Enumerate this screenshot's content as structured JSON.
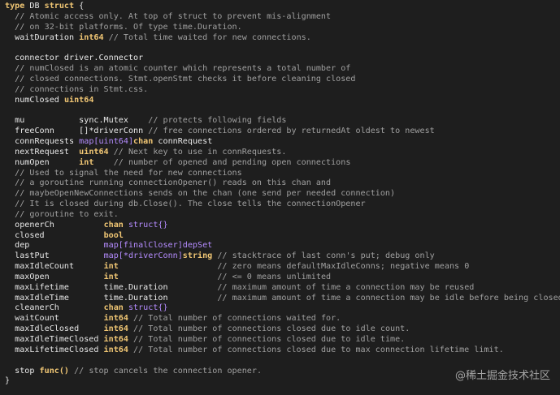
{
  "code": {
    "header": {
      "kw_type": "type",
      "name": "DB",
      "kw_struct": "struct",
      "brace": "{"
    },
    "lines": [
      "// Atomic access only. At top of struct to prevent mis-alignment",
      "// on 32-bit platforms. Of type time.Duration.",
      "waitDuration",
      "int64",
      "// Total time waited for new connections.",
      "connector driver.Connector",
      "// numClosed is an atomic counter which represents a total number of",
      "// closed connections. Stmt.openStmt checks it before cleaning closed",
      "// connections in Stmt.css.",
      "numClosed",
      "uint64"
    ],
    "fields": {
      "mu": {
        "name": "mu",
        "type": "sync.Mutex",
        "comment": "// protects following fields"
      },
      "freeConn": {
        "name": "freeConn",
        "type": "[]*driverConn",
        "comment": "// free connections ordered by returnedAt oldest to newest"
      },
      "connRequests": {
        "name": "connRequests",
        "type": "map[uint64]",
        "type2": "chan",
        "type3": "connRequest"
      },
      "nextRequest": {
        "name": "nextRequest",
        "type": "uint64",
        "comment": "// Next key to use in connRequests."
      },
      "numOpen": {
        "name": "numOpen",
        "type": "int",
        "comment": "// number of opened and pending open connections"
      },
      "c1": "// Used to signal the need for new connections",
      "c2": "// a goroutine running connectionOpener() reads on this chan and",
      "c3": "// maybeOpenNewConnections sends on the chan (one send per needed connection)",
      "c4": "// It is closed during db.Close(). The close tells the connectionOpener",
      "c5": "// goroutine to exit.",
      "openerCh": {
        "name": "openerCh",
        "type": "chan",
        "type2": "struct{}"
      },
      "closed": {
        "name": "closed",
        "type": "bool"
      },
      "dep": {
        "name": "dep",
        "type": "map[finalCloser]depSet"
      },
      "lastPut": {
        "name": "lastPut",
        "type": "map[*driverConn]",
        "type2": "string",
        "comment": "// stacktrace of last conn's put; debug only"
      },
      "maxIdleCount": {
        "name": "maxIdleCount",
        "type": "int",
        "comment": "// zero means defaultMaxIdleConns; negative means 0"
      },
      "maxOpen": {
        "name": "maxOpen",
        "type": "int",
        "comment": "// <= 0 means unlimited"
      },
      "maxLifetime": {
        "name": "maxLifetime",
        "type": "time.Duration",
        "comment": "// maximum amount of time a connection may be reused"
      },
      "maxIdleTime": {
        "name": "maxIdleTime",
        "type": "time.Duration",
        "comment": "// maximum amount of time a connection may be idle before being closed"
      },
      "cleanerCh": {
        "name": "cleanerCh",
        "type": "chan",
        "type2": "struct{}"
      },
      "waitCount": {
        "name": "waitCount",
        "type": "int64",
        "comment": "// Total number of connections waited for."
      },
      "maxIdleClosed": {
        "name": "maxIdleClosed",
        "type": "int64",
        "comment": "// Total number of connections closed due to idle count."
      },
      "maxIdleTimeClosed": {
        "name": "maxIdleTimeClosed",
        "type": "int64",
        "comment": "// Total number of connections closed due to idle time."
      },
      "maxLifetimeClosed": {
        "name": "maxLifetimeClosed",
        "type": "int64",
        "comment": "// Total number of connections closed due to max connection lifetime limit."
      },
      "stop": {
        "name": "stop",
        "type": "func()",
        "comment": "// stop cancels the connection opener."
      }
    },
    "closing_brace": "}"
  },
  "watermark": "@稀土掘金技术社区"
}
